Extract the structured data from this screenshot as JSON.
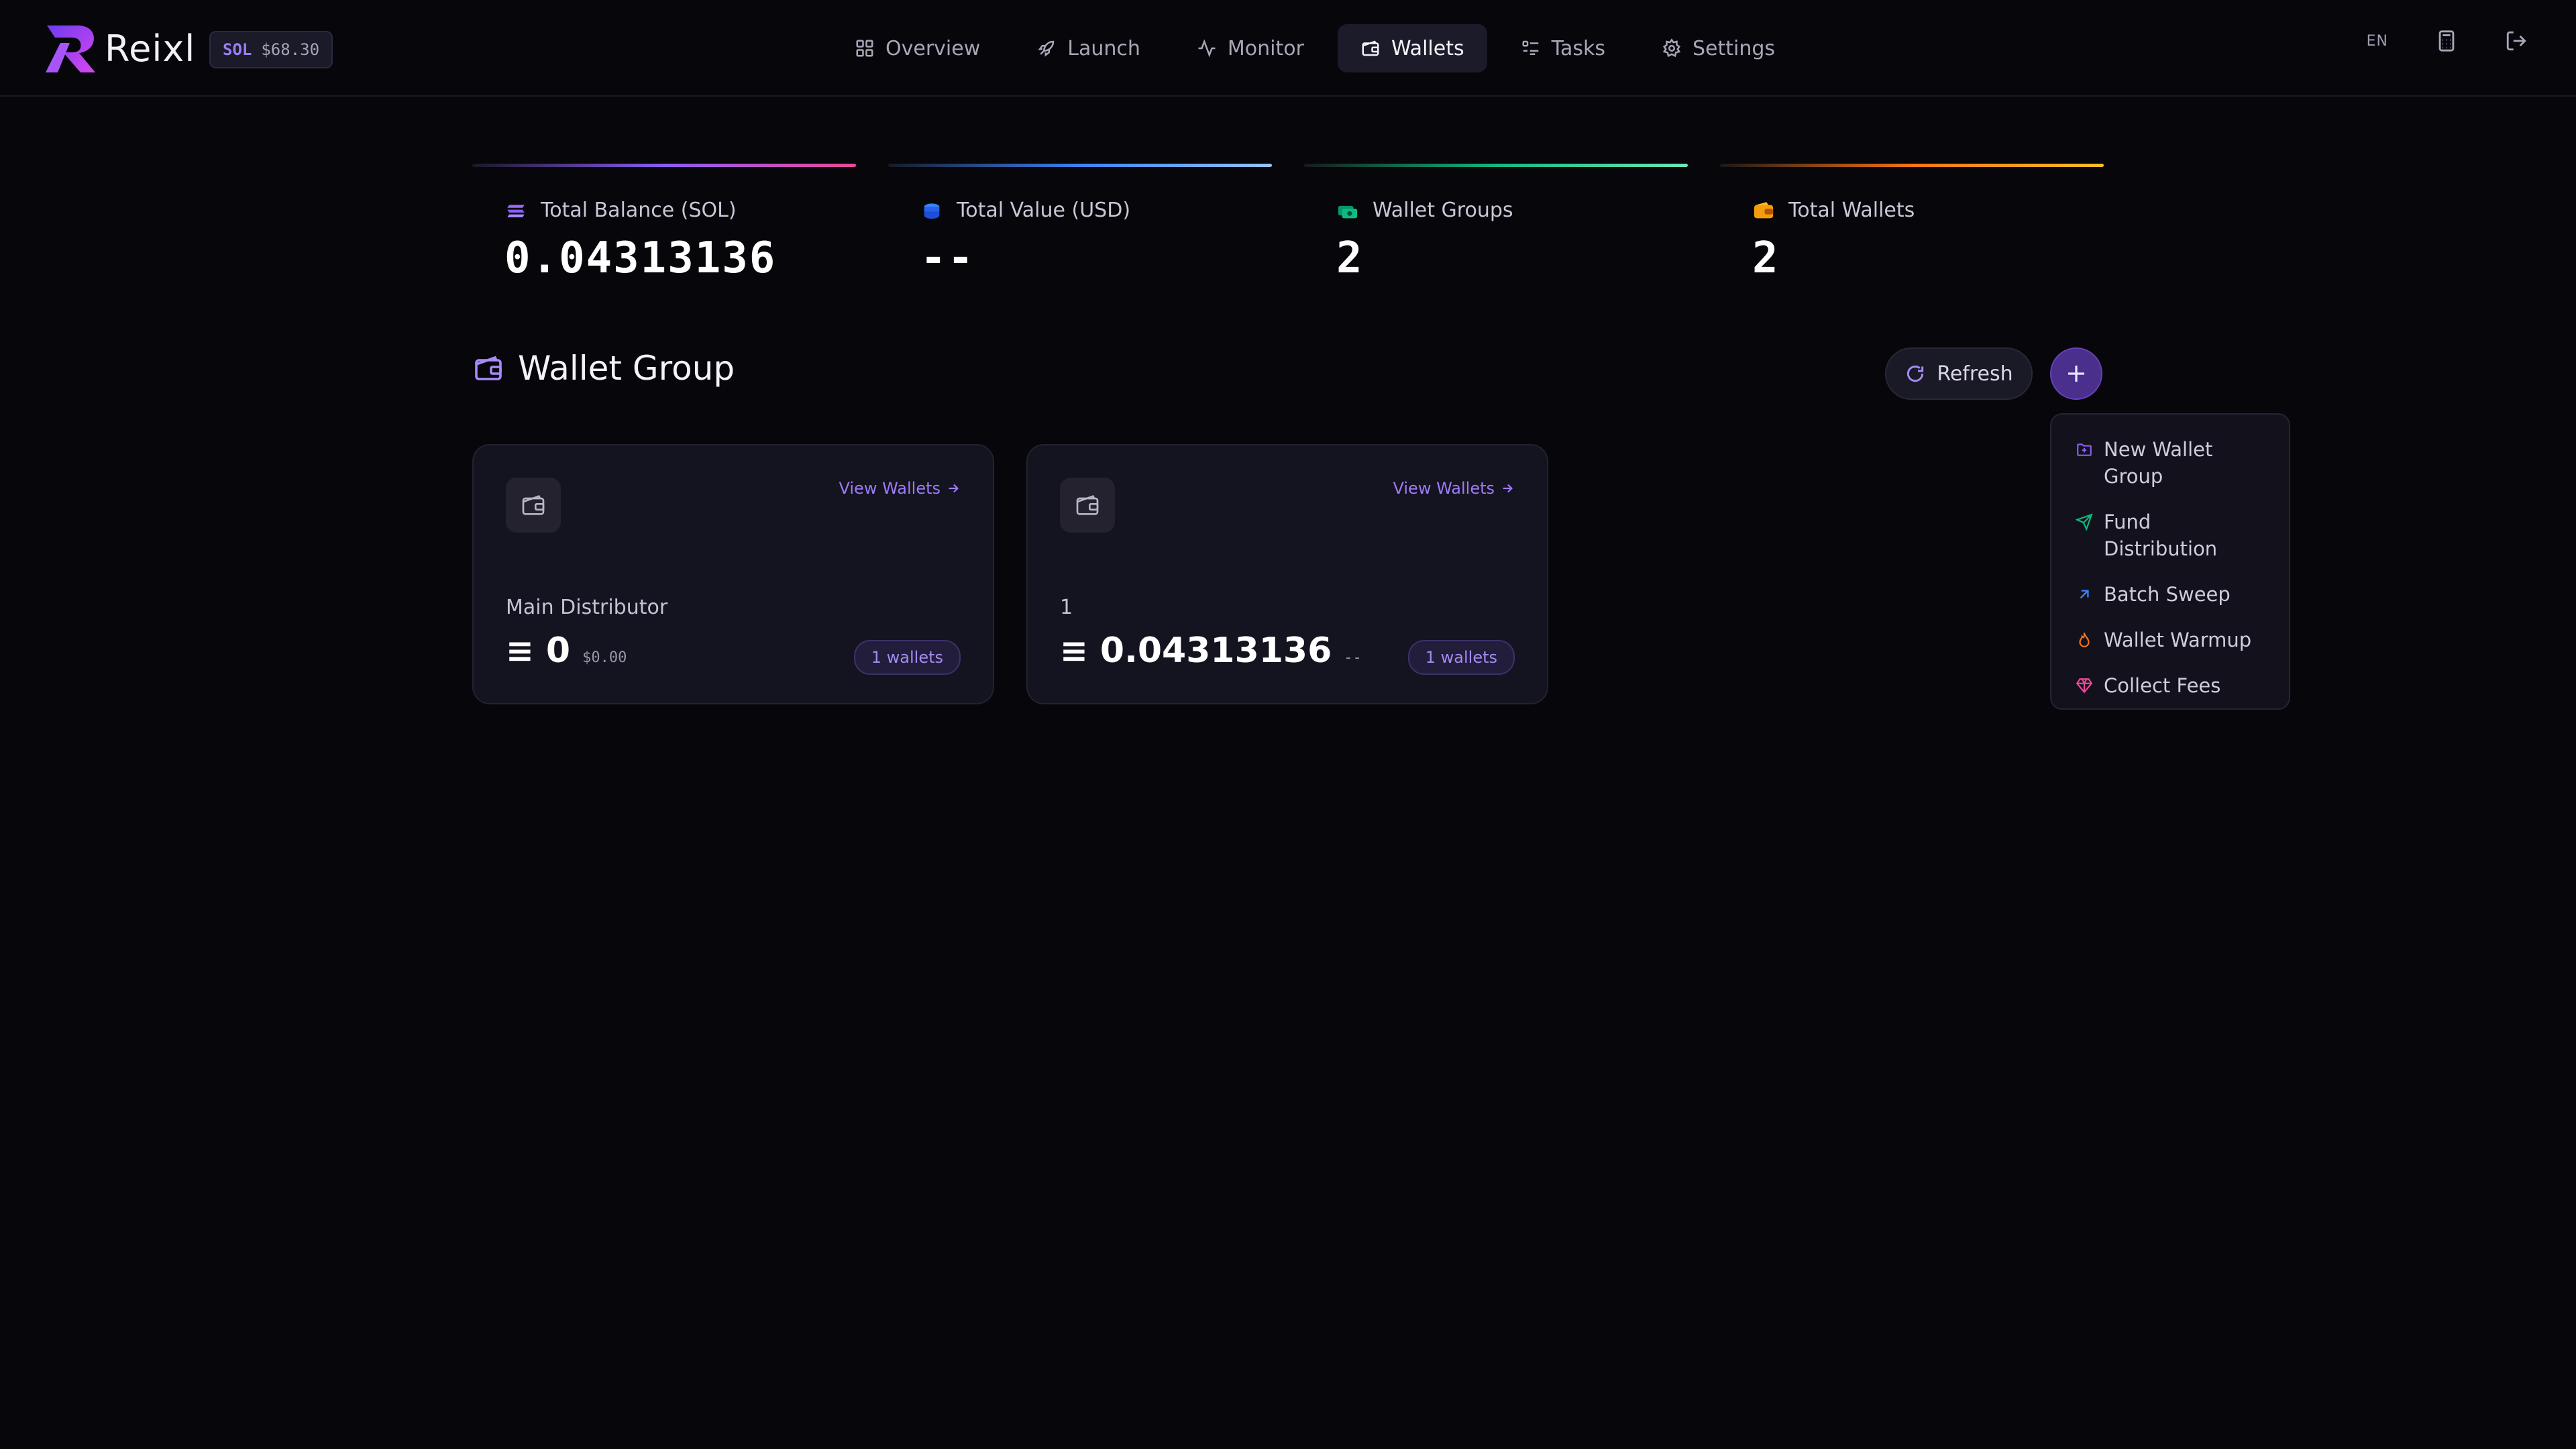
{
  "brand": {
    "name": "Reixl"
  },
  "price_badge": {
    "symbol": "SOL",
    "value": "$68.30"
  },
  "nav": {
    "items": [
      {
        "label": "Overview",
        "icon": "grid-icon"
      },
      {
        "label": "Launch",
        "icon": "rocket-icon"
      },
      {
        "label": "Monitor",
        "icon": "activity-icon"
      },
      {
        "label": "Wallets",
        "icon": "wallet-icon",
        "active": true
      },
      {
        "label": "Tasks",
        "icon": "list-icon"
      },
      {
        "label": "Settings",
        "icon": "gear-icon"
      }
    ]
  },
  "topbar": {
    "language": "EN"
  },
  "stats": [
    {
      "label": "Total Balance (SOL)",
      "value": "0.04313136",
      "color": "#8b5cf6"
    },
    {
      "label": "Total Value (USD)",
      "value": "--",
      "color": "#3b82f6"
    },
    {
      "label": "Wallet Groups",
      "value": "2",
      "color": "#10b981"
    },
    {
      "label": "Total Wallets",
      "value": "2",
      "color": "#f59e0b"
    }
  ],
  "section": {
    "title": "Wallet Group"
  },
  "actions": {
    "refresh_label": "Refresh"
  },
  "menu": {
    "items": [
      {
        "label": "New Wallet Group",
        "icon": "folder-plus-icon",
        "color": "#8b5cf6"
      },
      {
        "label": "Fund Distribution",
        "icon": "send-icon",
        "color": "#10b981"
      },
      {
        "label": "Batch Sweep",
        "icon": "arrow-up-right-icon",
        "color": "#3b82f6"
      },
      {
        "label": "Wallet Warmup",
        "icon": "flame-icon",
        "color": "#f97316"
      },
      {
        "label": "Collect Fees",
        "icon": "gem-icon",
        "color": "#ec4899"
      }
    ]
  },
  "groups": [
    {
      "name": "Main Distributor",
      "balance": "0",
      "usd": "$0.00",
      "wallet_count": "1 wallets",
      "view_label": "View Wallets"
    },
    {
      "name": "1",
      "balance": "0.04313136",
      "usd": "--",
      "wallet_count": "1 wallets",
      "view_label": "View Wallets"
    }
  ]
}
